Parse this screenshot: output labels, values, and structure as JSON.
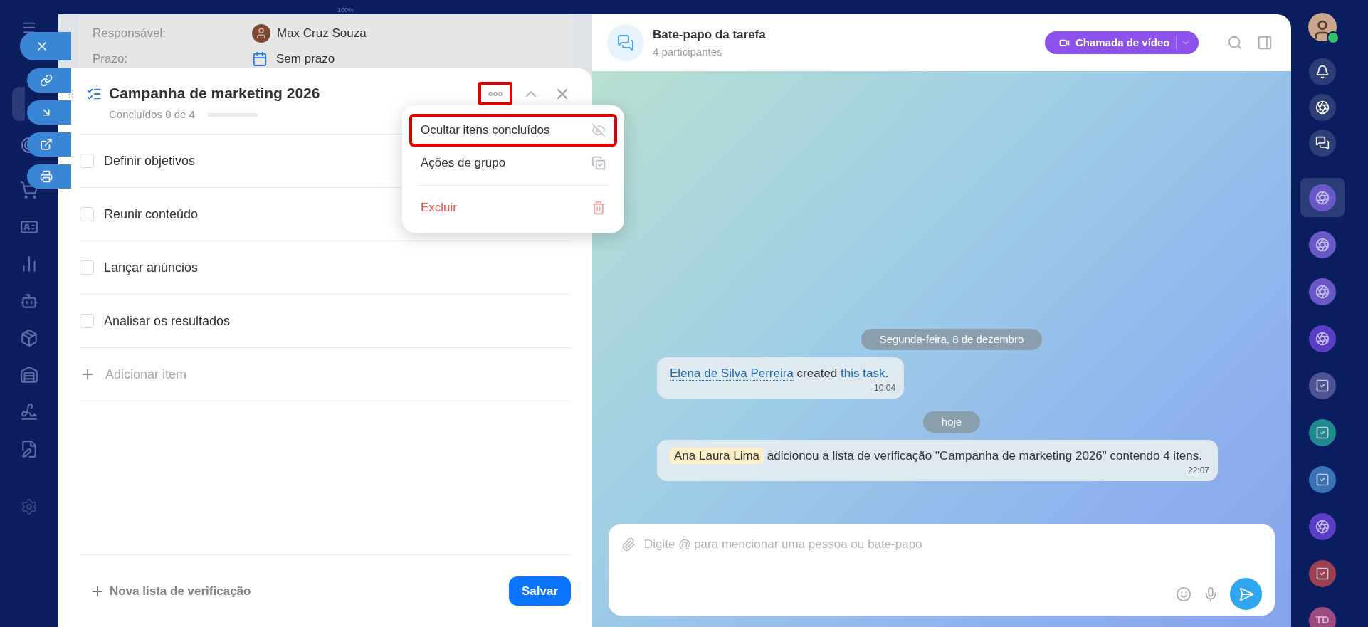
{
  "zoom_label": "100%",
  "task": {
    "fields": [
      {
        "label": "Responsável:",
        "value": "Max Cruz Souza",
        "kind": "person"
      },
      {
        "label": "Prazo:",
        "value": "Sem prazo",
        "kind": "date"
      }
    ]
  },
  "checklist": {
    "title": "Campanha de marketing 2026",
    "progress_label": "Concluídos 0 de 4",
    "level": 0,
    "more_highlighted": true,
    "items": [
      {
        "label": "Definir objetivos",
        "checked": false
      },
      {
        "label": "Reunir conteúdo",
        "checked": false
      },
      {
        "label": "Lançar anúncios",
        "checked": false
      },
      {
        "label": "Analisar os resultados",
        "checked": false
      }
    ],
    "add_item": "Adicionar item",
    "new_list": "Nova lista de verificação",
    "save": "Salvar"
  },
  "menu": {
    "items": [
      {
        "label": "Ocultar itens concluídos",
        "kind": "hide",
        "highlighted": true
      },
      {
        "label": "Ações de grupo",
        "kind": "group",
        "highlighted": false
      },
      {
        "label": "Excluir",
        "kind": "delete",
        "highlighted": false
      }
    ]
  },
  "chat": {
    "title": "Bate-papo da tarefa",
    "subtitle": "4 participantes",
    "video_button": "Chamada de vídeo",
    "messages": [
      {
        "kind": "date",
        "text": "Segunda-feira, 8 de dezembro"
      },
      {
        "kind": "message",
        "time": "10:04",
        "parts": [
          {
            "kind": "link",
            "text": "Elena de Silva Perreira"
          },
          {
            "kind": "text",
            "text": " created "
          },
          {
            "kind": "link",
            "text": "this task"
          },
          {
            "kind": "text",
            "text": "."
          }
        ]
      },
      {
        "kind": "date",
        "text": "hoje"
      },
      {
        "kind": "message",
        "time": "22:07",
        "parts": [
          {
            "kind": "mention",
            "text": "Ana Laura Lima"
          },
          {
            "kind": "text",
            "text": " adicionou a lista de verificação \"Campanha de marketing 2026\" contendo 4 itens."
          }
        ]
      }
    ],
    "input_placeholder": "Digite @ para mencionar uma pessoa ou bate-papo"
  },
  "rail": {
    "items": [
      {
        "kind": "copilot",
        "color": "#6a58c8",
        "selected": true
      },
      {
        "kind": "copilot",
        "color": "#6a58c8",
        "selected": false
      },
      {
        "kind": "copilot",
        "color": "#6a58c8",
        "selected": false
      },
      {
        "kind": "copilot",
        "color": "#5a3ec8",
        "selected": false
      },
      {
        "kind": "task",
        "color": "#4e5394",
        "selected": false
      },
      {
        "kind": "task",
        "color": "#1f8a8f",
        "selected": false
      },
      {
        "kind": "task",
        "color": "#3a72b8",
        "selected": false
      },
      {
        "kind": "copilot",
        "color": "#5a3ec8",
        "selected": false
      },
      {
        "kind": "task",
        "color": "#9e3f52",
        "selected": false
      },
      {
        "kind": "initials",
        "text": "TD",
        "color": "#9c4a80",
        "selected": false
      }
    ]
  }
}
